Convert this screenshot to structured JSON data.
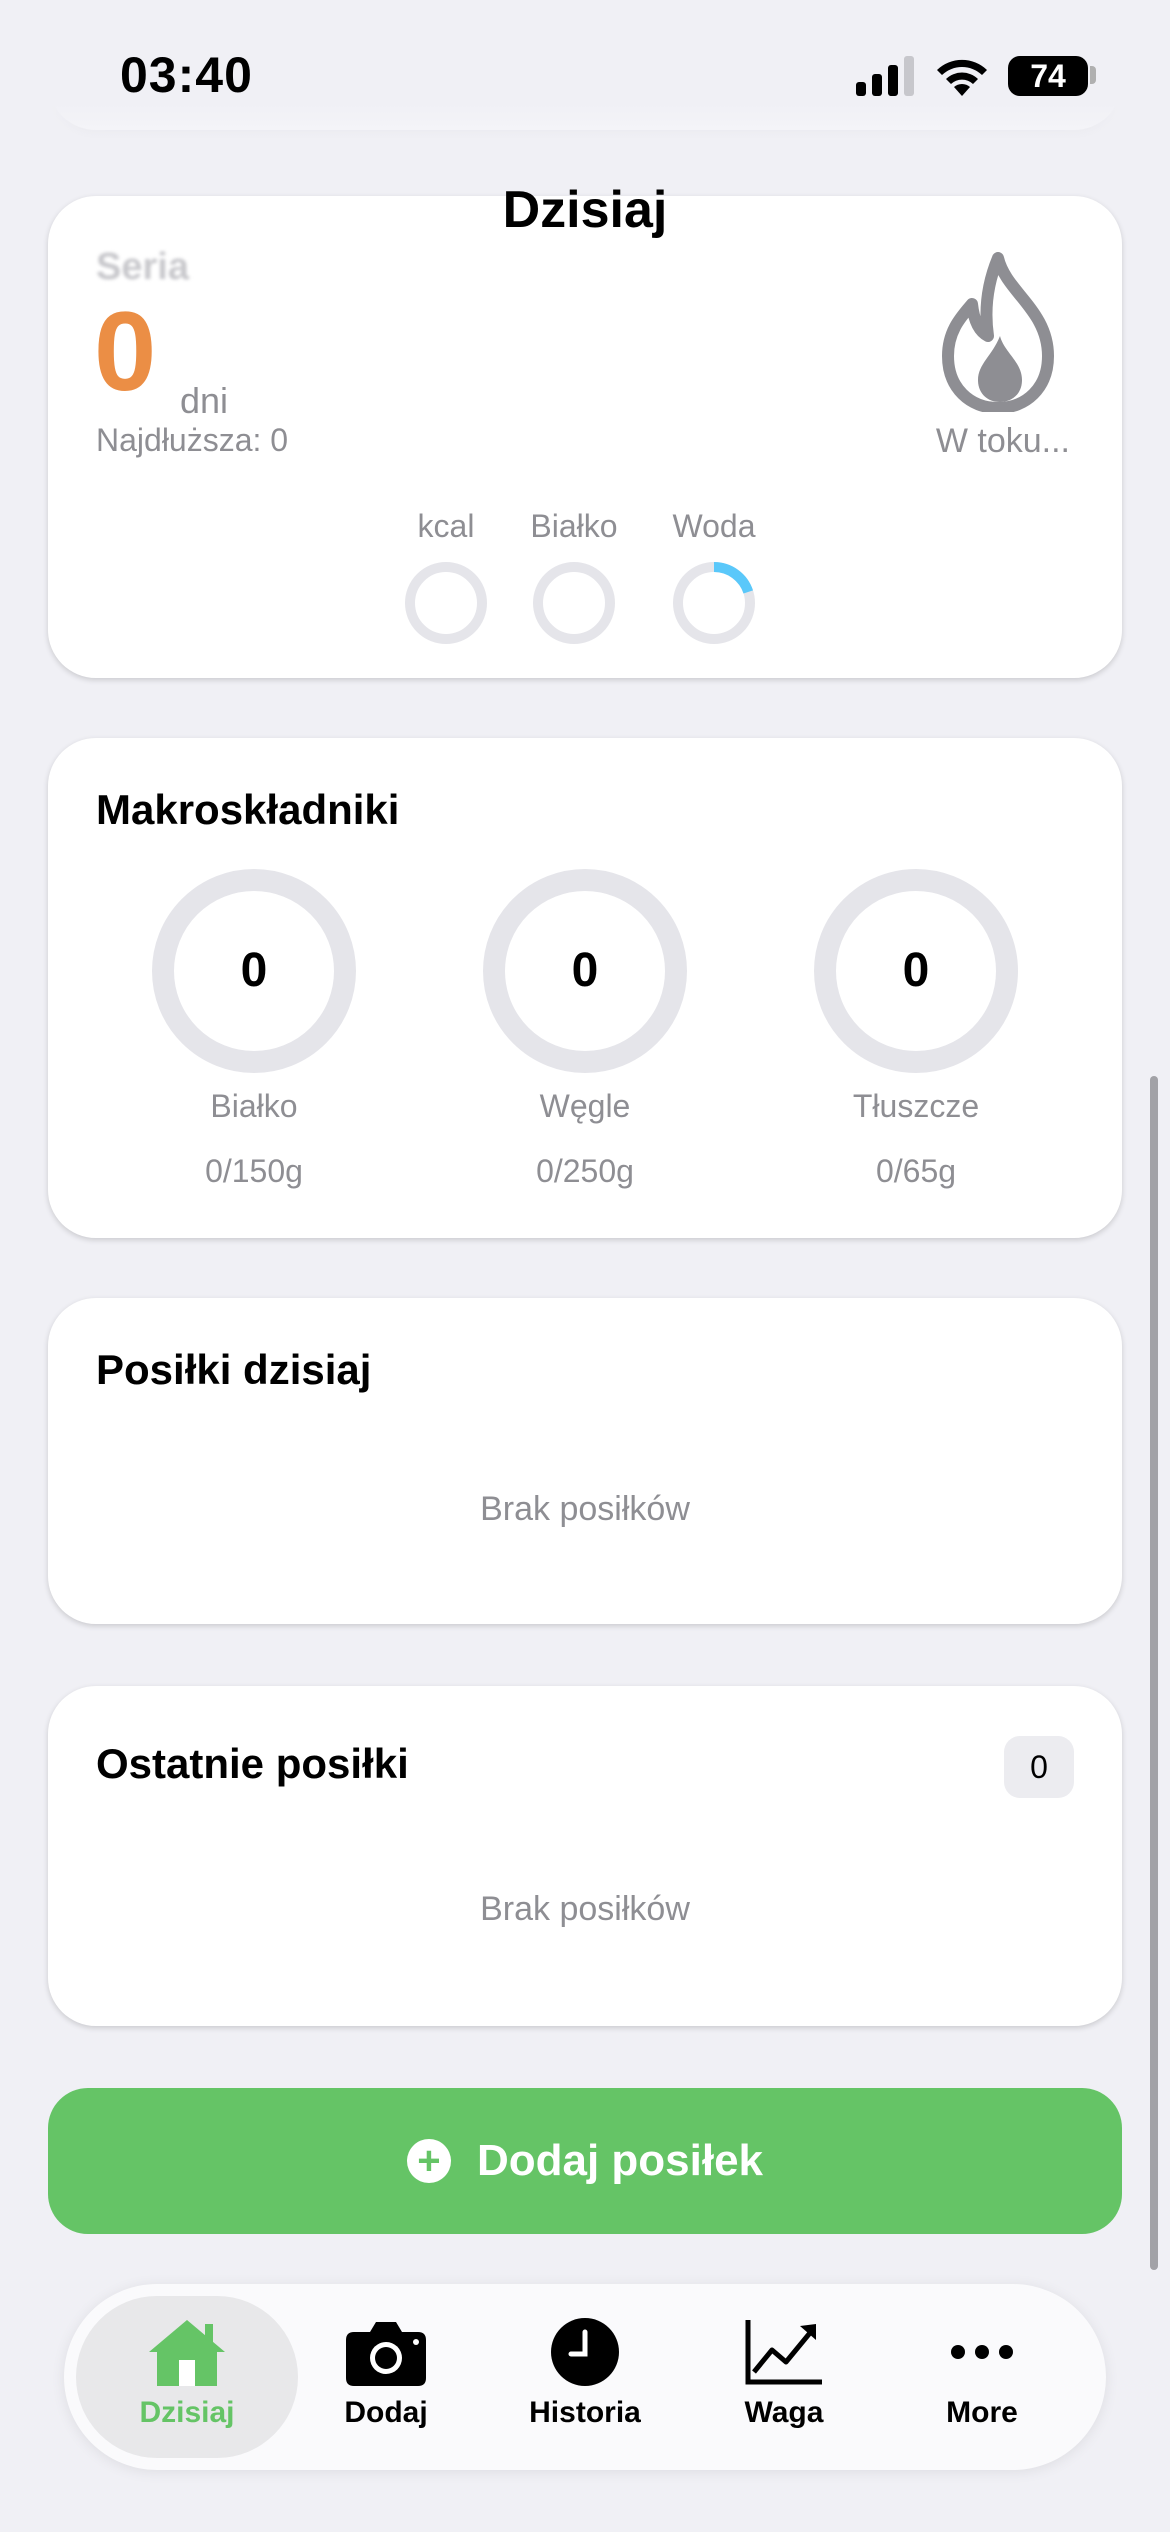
{
  "status_bar": {
    "time": "03:40",
    "battery": "74"
  },
  "nav": {
    "title": "Dzisiaj"
  },
  "streak": {
    "label": "Seria",
    "count": "0",
    "unit": "dni",
    "longest": "Najdłuższa: 0",
    "status": "W toku...",
    "rings": [
      {
        "label": "kcal",
        "progress": 0
      },
      {
        "label": "Białko",
        "progress": 0
      },
      {
        "label": "Woda",
        "progress": 0.2
      }
    ]
  },
  "macros": {
    "title": "Makroskładniki",
    "items": [
      {
        "value": "0",
        "name": "Białko",
        "amount": "0/150g"
      },
      {
        "value": "0",
        "name": "Węgle",
        "amount": "0/250g"
      },
      {
        "value": "0",
        "name": "Tłuszcze",
        "amount": "0/65g"
      }
    ]
  },
  "meals_today": {
    "title": "Posiłki dzisiaj",
    "empty": "Brak posiłków"
  },
  "recent_meals": {
    "title": "Ostatnie posiłki",
    "count": "0",
    "empty": "Brak posiłków"
  },
  "add_button": {
    "label": "Dodaj posiłek"
  },
  "tabbar": {
    "tabs": [
      {
        "label": "Dzisiaj",
        "icon": "house-icon",
        "active": true
      },
      {
        "label": "Dodaj",
        "icon": "camera-icon"
      },
      {
        "label": "Historia",
        "icon": "clock-icon"
      },
      {
        "label": "Waga",
        "icon": "chart-line-icon"
      },
      {
        "label": "More",
        "icon": "ellipsis-icon"
      }
    ]
  },
  "colors": {
    "accent_green": "#65c466",
    "streak_orange": "#eb8e45",
    "water_blue": "#5ac8fa",
    "ring_track": "#e5e5ea"
  }
}
